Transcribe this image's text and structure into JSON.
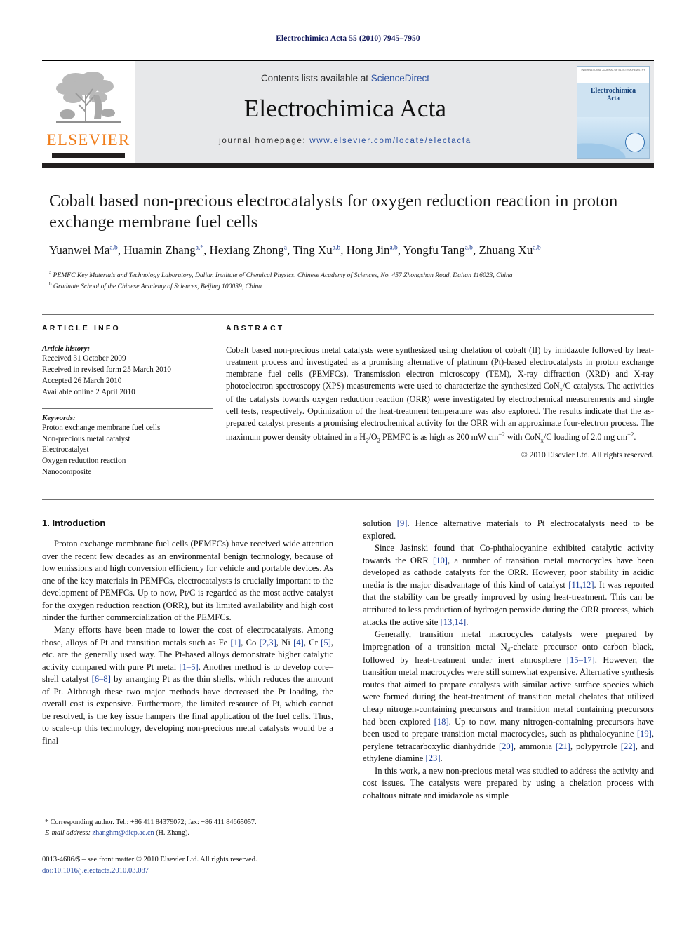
{
  "running_head": "Electrochimica Acta 55 (2010) 7945–7950",
  "masthead": {
    "contents_prefix": "Contents lists available at ",
    "sciencedirect": "ScienceDirect",
    "journal_title": "Electrochimica Acta",
    "homepage_prefix": "journal homepage: ",
    "homepage_url": "www.elsevier.com/locate/electacta",
    "publisher": "ELSEVIER",
    "cover": {
      "line1": "Electrochimica",
      "line2": "Acta",
      "top_note": "INTERNATIONAL JOURNAL OF ELECTROCHEMISTRY"
    }
  },
  "article": {
    "title": "Cobalt based non-precious electrocatalysts for oxygen reduction reaction in proton exchange membrane fuel cells",
    "authors_html": "Yuanwei Ma<sup>a,b</sup>, Huamin Zhang<sup>a,</sup><sup>*</sup>, Hexiang Zhong<sup>a</sup>, Ting Xu<sup>a,b</sup>, Hong Jin<sup>a,b</sup>, Yongfu Tang<sup>a,b</sup>, Zhuang Xu<sup>a,b</sup>",
    "affiliation_a": "PEMFC Key Materials and Technology Laboratory, Dalian Institute of Chemical Physics, Chinese Academy of Sciences, No. 457 Zhongshan Road, Dalian 116023, China",
    "affiliation_b": "Graduate School of the Chinese Academy of Sciences, Beijing 100039, China"
  },
  "info": {
    "heading": "ARTICLE INFO",
    "history_label": "Article history:",
    "history": [
      "Received 31 October 2009",
      "Received in revised form 25 March 2010",
      "Accepted 26 March 2010",
      "Available online 2 April 2010"
    ],
    "keywords_label": "Keywords:",
    "keywords": [
      "Proton exchange membrane fuel cells",
      "Non-precious metal catalyst",
      "Electrocatalyst",
      "Oxygen reduction reaction",
      "Nanocomposite"
    ]
  },
  "abstract": {
    "heading": "ABSTRACT",
    "text_html": "Cobalt based non-precious metal catalysts were synthesized using chelation of cobalt (II) by imidazole followed by heat-treatment process and investigated as a promising alternative of platinum (Pt)-based electrocatalysts in proton exchange membrane fuel cells (PEMFCs). Transmission electron microscopy (TEM), X-ray diffraction (XRD) and X-ray photoelectron spectroscopy (XPS) measurements were used to characterize the synthesized CoN<sub>x</sub>/C catalysts. The activities of the catalysts towards oxygen reduction reaction (ORR) were investigated by electrochemical measurements and single cell tests, respectively. Optimization of the heat-treatment temperature was also explored. The results indicate that the as-prepared catalyst presents a promising electrochemical activity for the ORR with an approximate four-electron process. The maximum power density obtained in a H<sub>2</sub>/O<sub>2</sub> PEMFC is as high as 200 mW cm<sup class=\"num\">−2</sup> with CoN<sub>x</sub>/C loading of 2.0 mg cm<sup class=\"num\">−2</sup>.",
    "copyright": "© 2010 Elsevier Ltd. All rights reserved."
  },
  "body": {
    "section_title": "1. Introduction",
    "left_paragraphs_html": [
      "Proton exchange membrane fuel cells (PEMFCs) have received wide attention over the recent few decades as an environmental benign technology, because of low emissions and high conversion efficiency for vehicle and portable devices. As one of the key materials in PEMFCs, electrocatalysts is crucially important to the development of PEMFCs. Up to now, Pt/C is regarded as the most active catalyst for the oxygen reduction reaction (ORR), but its limited availability and high cost hinder the further commercialization of the PEMFCs.",
      "Many efforts have been made to lower the cost of electrocatalysts. Among those, alloys of Pt and transition metals such as Fe <span class=\"ref\">[1]</span>, Co <span class=\"ref\">[2,3]</span>, Ni <span class=\"ref\">[4]</span>, Cr <span class=\"ref\">[5]</span>, etc. are the generally used way. The Pt-based alloys demonstrate higher catalytic activity compared with pure Pt metal <span class=\"ref\">[1–5]</span>. Another method is to develop core–shell catalyst <span class=\"ref\">[6–8]</span> by arranging Pt as the thin shells, which reduces the amount of Pt. Although these two major methods have decreased the Pt loading, the overall cost is expensive. Furthermore, the limited resource of Pt, which cannot be resolved, is the key issue hampers the final application of the fuel cells. Thus, to scale-up this technology, developing non-precious metal catalysts would be a final"
    ],
    "right_paragraphs_html": [
      "solution <span class=\"ref\">[9]</span>. Hence alternative materials to Pt electrocatalysts need to be explored.",
      "Since Jasinski found that Co-phthalocyanine exhibited catalytic activity towards the ORR <span class=\"ref\">[10]</span>, a number of transition metal macrocycles have been developed as cathode catalysts for the ORR. However, poor stability in acidic media is the major disadvantage of this kind of catalyst <span class=\"ref\">[11,12]</span>. It was reported that the stability can be greatly improved by using heat-treatment. This can be attributed to less production of hydrogen peroxide during the ORR process, which attacks the active site <span class=\"ref\">[13,14]</span>.",
      "Generally, transition metal macrocycles catalysts were prepared by impregnation of a transition metal N<sub>4</sub>-chelate precursor onto carbon black, followed by heat-treatment under inert atmosphere <span class=\"ref\">[15–17]</span>. However, the transition metal macrocycles were still somewhat expensive. Alternative synthesis routes that aimed to prepare catalysts with similar active surface species which were formed during the heat-treatment of transition metal chelates that utilized cheap nitrogen-containing precursors and transition metal containing precursors had been explored <span class=\"ref\">[18]</span>. Up to now, many nitrogen-containing precursors have been used to prepare transition metal macrocycles, such as phthalocyanine <span class=\"ref\">[19]</span>, perylene tetracarboxylic dianhydride <span class=\"ref\">[20]</span>, ammonia <span class=\"ref\">[21]</span>, polypyrrole <span class=\"ref\">[22]</span>, and ethylene diamine <span class=\"ref\">[23]</span>.",
      "In this work, a new non-precious metal was studied to address the activity and cost issues. The catalysts were prepared by using a chelation process with cobaltous nitrate and imidazole as simple"
    ]
  },
  "footnote": {
    "corresponding_html": "* Corresponding author. Tel.: +86 411 84379072; fax: +86 411 84665057.",
    "email_label": "E-mail address:",
    "email": "zhanghm@dicp.ac.cn",
    "email_suffix": "(H. Zhang)."
  },
  "imprint": {
    "line1": "0013-4686/$ – see front matter © 2010 Elsevier Ltd. All rights reserved.",
    "doi_label": "doi:",
    "doi": "10.1016/j.electacta.2010.03.087"
  },
  "colors": {
    "link": "#1d3f99",
    "running_head": "#131a5c",
    "elsevier_orange": "#f07d1a",
    "masthead_bg": "#e7e8ea"
  }
}
